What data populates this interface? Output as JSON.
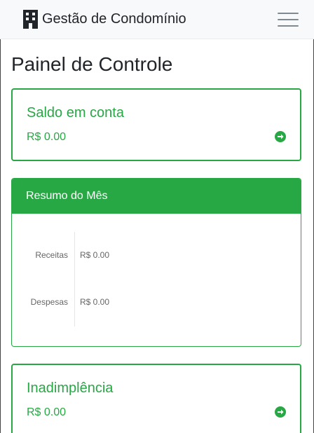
{
  "navbar": {
    "brand": "Gestão de Condomínio",
    "brand_icon": "building-icon",
    "toggle_icon": "hamburger-menu-icon"
  },
  "page": {
    "title": "Painel de Controle"
  },
  "cards": {
    "balance": {
      "title": "Saldo em conta",
      "value": "R$ 0.00",
      "action_icon": "arrow-circle-right-icon"
    },
    "defaults": {
      "title": "Inadimplência",
      "value": "R$ 0.00",
      "action_icon": "arrow-circle-right-icon"
    }
  },
  "monthly_summary": {
    "header": "Resumo do Mês",
    "chart_data": {
      "type": "bar",
      "orientation": "horizontal",
      "categories": [
        "Receitas",
        "Despesas"
      ],
      "values": [
        0,
        0
      ],
      "value_labels": [
        "R$ 0.00",
        "R$ 0.00"
      ],
      "colors": [
        "#28a745",
        "#dc3545"
      ]
    }
  },
  "colors": {
    "accent": "#28a745",
    "navbar_bg": "#f8f9fa"
  }
}
